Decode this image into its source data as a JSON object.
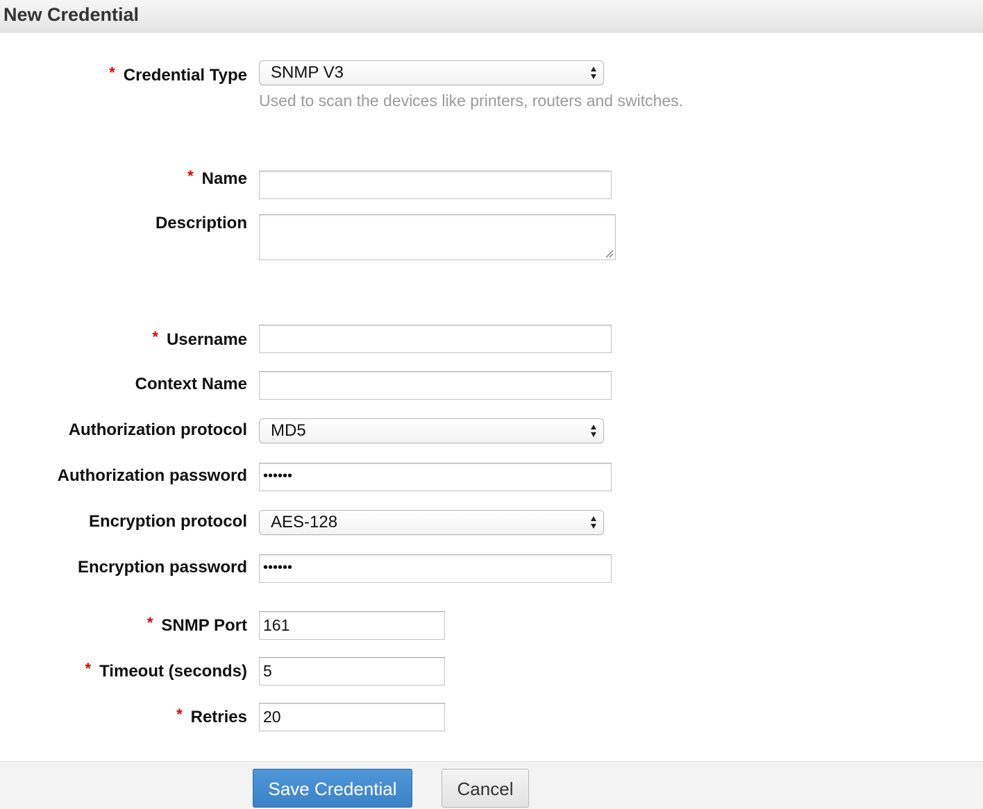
{
  "window": {
    "title": "New Credential"
  },
  "form": {
    "credential_type": {
      "label": "Credential Type",
      "required_marker": "*",
      "selected": "SNMP V3",
      "hint": "Used to scan the devices like printers, routers and switches."
    },
    "name": {
      "label": "Name",
      "required_marker": "*",
      "value": ""
    },
    "description": {
      "label": "Description",
      "value": ""
    },
    "username": {
      "label": "Username",
      "required_marker": "*",
      "value": ""
    },
    "context_name": {
      "label": "Context Name",
      "value": ""
    },
    "authorization_protocol": {
      "label": "Authorization protocol",
      "selected": "MD5"
    },
    "authorization_password": {
      "label": "Authorization password",
      "masked_value": "••••••"
    },
    "encryption_protocol": {
      "label": "Encryption protocol",
      "selected": "AES-128"
    },
    "encryption_password": {
      "label": "Encryption password",
      "masked_value": "••••••"
    },
    "snmp_port": {
      "label": "SNMP Port",
      "required_marker": "*",
      "value": "161"
    },
    "timeout": {
      "label": "Timeout (seconds)",
      "required_marker": "*",
      "value": "5"
    },
    "retries": {
      "label": "Retries",
      "required_marker": "*",
      "value": "20"
    }
  },
  "footer": {
    "save_label": "Save Credential",
    "cancel_label": "Cancel"
  },
  "colors": {
    "required": "#e00000",
    "primary_button": "#3b82c6",
    "hint_text": "#9a9a9a"
  },
  "icons": {
    "select_arrows": "select-arrows-icon",
    "resize_grip": "resize-grip-icon"
  }
}
